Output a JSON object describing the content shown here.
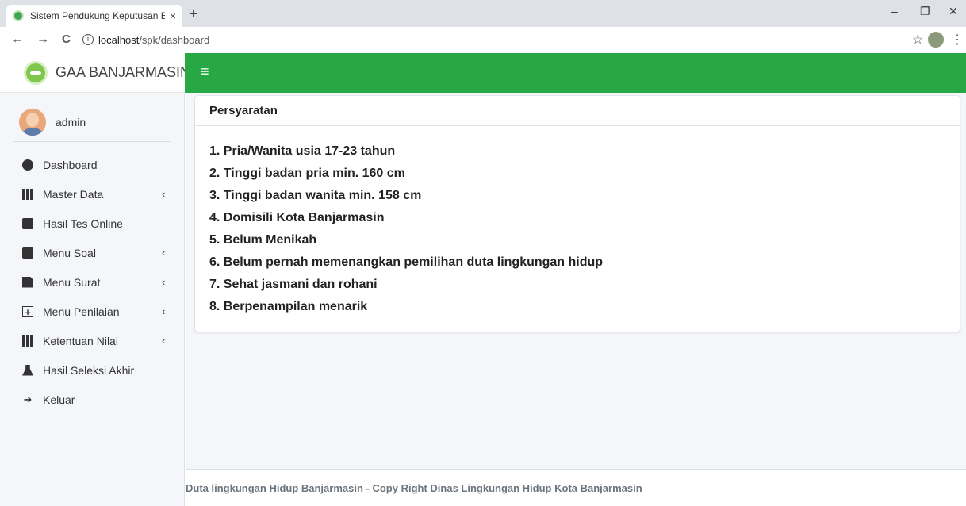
{
  "browser": {
    "tab_title": "Sistem Pendukung Keputusan Be",
    "tab_close": "×",
    "new_tab": "+",
    "url_host": "localhost",
    "url_path": "/spk/dashboard",
    "info": "i",
    "back": "←",
    "forward": "→",
    "reload": "C",
    "star": "☆",
    "menu": "⋮",
    "minimize": "–",
    "maximize": "❐",
    "close": "✕"
  },
  "brand": {
    "name": "GAA BANJARMASIN"
  },
  "topnav": {
    "toggle": "≡",
    "color": "#28a745"
  },
  "user": {
    "name": "admin"
  },
  "sidebar": {
    "items": [
      {
        "label": "Dashboard",
        "icon": "tachometer-icon",
        "submenu": false
      },
      {
        "label": "Master Data",
        "icon": "th-icon",
        "submenu": true
      },
      {
        "label": "Hasil Tes Online",
        "icon": "clone-icon",
        "submenu": false
      },
      {
        "label": "Menu Soal",
        "icon": "square-icon",
        "submenu": true
      },
      {
        "label": "Menu Surat",
        "icon": "file-icon",
        "submenu": true
      },
      {
        "label": "Menu Penilaian",
        "icon": "plus-square-icon",
        "submenu": true
      },
      {
        "label": "Ketentuan Nilai",
        "icon": "th-icon",
        "submenu": true
      },
      {
        "label": "Hasil Seleksi Akhir",
        "icon": "flask-icon",
        "submenu": false
      },
      {
        "label": "Keluar",
        "icon": "sign-out-icon",
        "submenu": false
      }
    ],
    "chevron": "‹"
  },
  "card": {
    "title": "Persyaratan",
    "requirements": [
      "1. Pria/Wanita usia 17-23 tahun",
      "2. Tinggi badan pria min. 160 cm",
      "3. Tinggi badan wanita min. 158 cm",
      "4. Domisili Kota Banjarmasin",
      "5. Belum Menikah",
      "6. Belum pernah memenangkan pemilihan duta lingkungan hidup",
      "7. Sehat jasmani dan rohani",
      "8. Berpenampilan menarik"
    ]
  },
  "footer": {
    "text": "Duta lingkungan Hidup Banjarmasin - Copy Right Dinas Lingkungan Hidup Kota Banjarmasin"
  }
}
